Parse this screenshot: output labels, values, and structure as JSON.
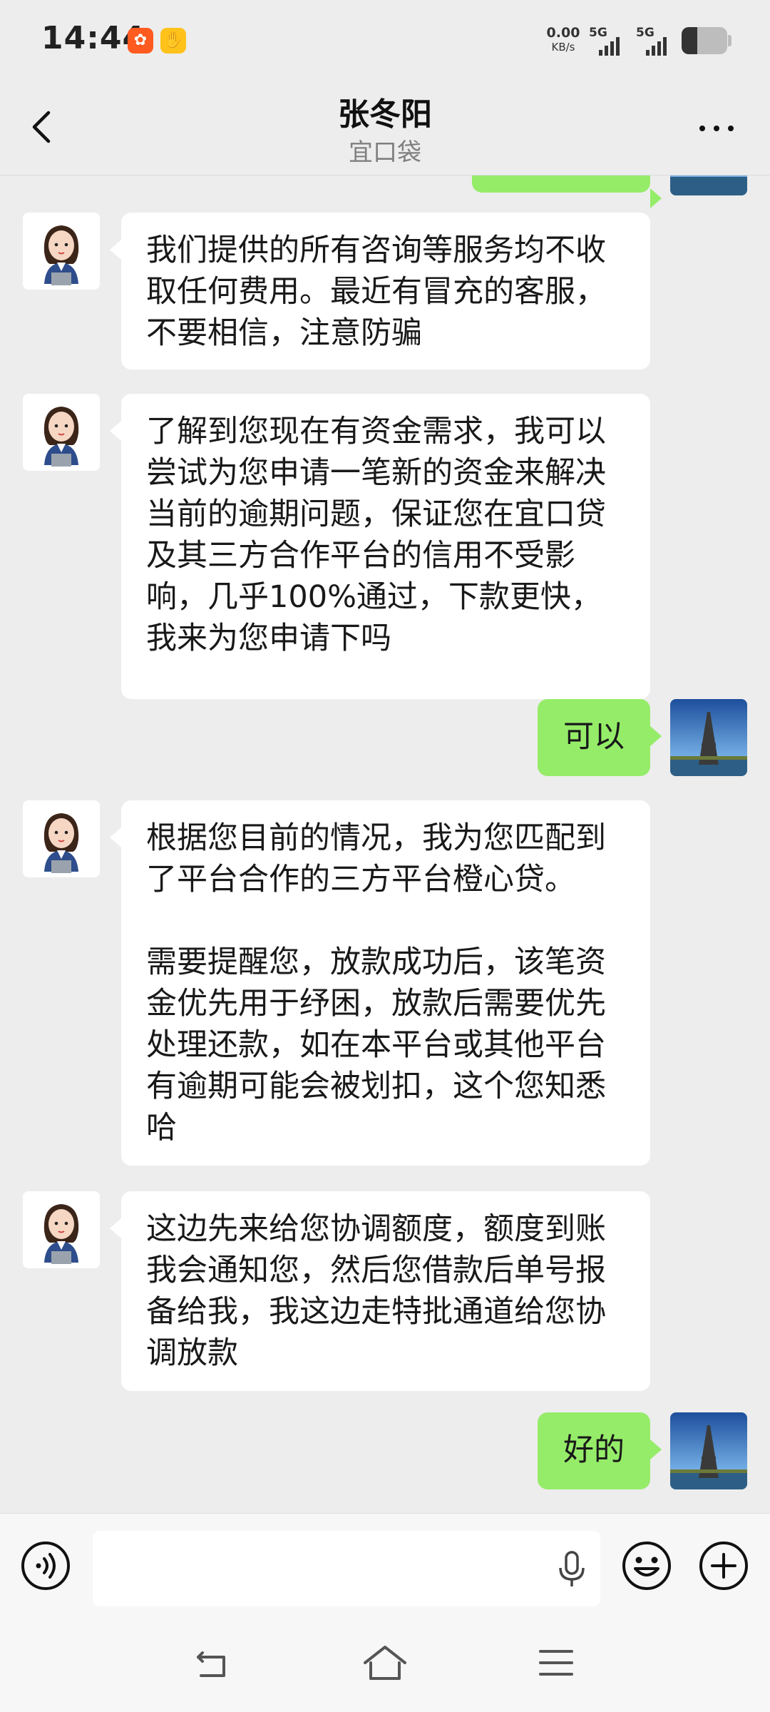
{
  "status_bar": {
    "time": "14:44",
    "net_speed_value": "0.00",
    "net_speed_unit": "KB/s",
    "sim1_label": "5G",
    "sim2_label": "5G",
    "battery_level": 0.35
  },
  "header": {
    "title": "张冬阳",
    "subtitle": "宜口袋"
  },
  "messages": [
    {
      "sender": "agent",
      "text": "我们提供的所有咨询等服务均不收取任何费用。最近有冒充的客服，不要相信，注意防骗"
    },
    {
      "sender": "agent",
      "text": "了解到您现在有资金需求，我可以尝试为您申请一笔新的资金来解决当前的逾期问题，保证您在宜口贷及其三方合作平台的信用不受影响，几乎100%通过，下款更快，我来为您申请下吗"
    },
    {
      "sender": "me",
      "text": "可以"
    },
    {
      "sender": "agent",
      "text": "根据您目前的情况，我为您匹配到了平台合作的三方平台橙心贷。\n\n需要提醒您，放款成功后，该笔资金优先用于纾困，放款后需要优先处理还款，如在本平台或其他平台有逾期可能会被划扣，这个您知悉哈"
    },
    {
      "sender": "agent",
      "text": "这边先来给您协调额度，额度到账我会通知您，然后您借款后单号报备给我，我这边走特批通道给您协调放款"
    },
    {
      "sender": "me",
      "text": "好的"
    }
  ],
  "icons": {
    "back": "chevron-left-icon",
    "more": "more-dots-icon",
    "voice": "voice-toggle-icon",
    "mic": "microphone-icon",
    "emoji": "emoji-icon",
    "plus": "plus-icon",
    "nav_back": "nav-back-icon",
    "nav_home": "nav-home-icon",
    "nav_menu": "nav-menu-icon"
  },
  "colors": {
    "my_bubble": "#95EC69",
    "other_bubble": "#FFFFFF",
    "chat_background": "#EDEDED"
  }
}
